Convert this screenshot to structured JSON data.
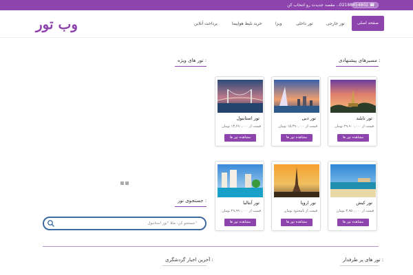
{
  "topbar": {
    "phone": "02188454802 ☎",
    "tagline": "مقصد جدیدت رو انتخاب کن ..."
  },
  "header": {
    "logo": "وب تور",
    "home": "صفحه اصلی",
    "nav": [
      "تور خارجی",
      "تور داخلی",
      "ویزا",
      "خرید بلیط هواپیما",
      "پرداخت آنلاین"
    ]
  },
  "sections": {
    "suggested": "مسیرهای پیشنهادی :",
    "special": "تور های ویژه :",
    "search": "جستجوی تور :",
    "popular": "تور های پر طرفدار :",
    "news": "آخرین اخبار گردشگری :"
  },
  "search": {
    "placeholder": "جستجو کن: مثلا \"تور استانبول\""
  },
  "tours": [
    {
      "name": "تور تایلند",
      "price": "قیمت از ۲۹,۹۰۰,۰۰۰ تومان",
      "button": "مشاهده تور ها",
      "image": "thailand-temple-sunset"
    },
    {
      "name": "تور دبی",
      "price": "قیمت از ۱۵,۴۹۰,۰۰۰ تومان",
      "button": "مشاهده تور ها",
      "image": "dubai-burj-al-arab"
    },
    {
      "name": "تور استانبول",
      "price": "قیمت از ۱۳,۶۹۰,۰۰۰ تومان",
      "button": "مشاهده تور ها",
      "image": "istanbul-bosphorus-bridge"
    },
    {
      "name": "تور کیش",
      "price": "قیمت از ۳,۹۵۰,۰۰۰ تومان",
      "button": "مشاهده تور ها",
      "image": "kish-island-beach"
    },
    {
      "name": "تور اروپا",
      "price": "قیمت از نامحدود تومان",
      "button": "مشاهده تور ها",
      "image": "paris-eiffel-tower"
    },
    {
      "name": "تور آنتالیا",
      "price": "قیمت از ۲۹,۹۹۰,۰۰۰ تومان",
      "button": "مشاهده تور ها",
      "image": "antalya-resort-pool"
    }
  ],
  "colors": {
    "accent": "#8e44ad",
    "search_border": "#3a6aa0"
  }
}
